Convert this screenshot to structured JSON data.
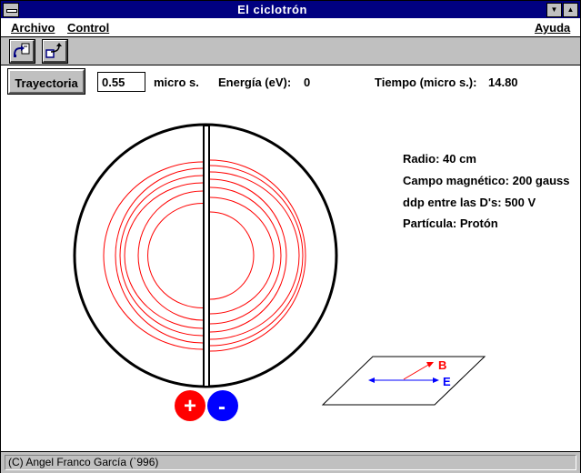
{
  "window": {
    "title": "El ciclotrón",
    "minimize_glyph": "▼",
    "maximize_glyph": "▲"
  },
  "menubar": {
    "archivo": {
      "label": "Archivo"
    },
    "control": {
      "label": "Control"
    },
    "ayuda": {
      "label": "Ayuda"
    }
  },
  "toolbar": {
    "icons": [
      "open-file-icon",
      "export-icon"
    ]
  },
  "controls": {
    "trayectoria_label": "Trayectoria",
    "time_value": "0.55",
    "time_unit": "micro s.",
    "energy_label": "Energía (eV):",
    "energy_value": "0",
    "tiempo_label": "Tiempo (micro s.):",
    "tiempo_value": "14.80"
  },
  "info": {
    "radio": "Radio: 40 cm",
    "campo": "Campo magnético: 200 gauss",
    "ddp": "ddp entre las D's: 500 V",
    "particula": "Partícula: Protón"
  },
  "terminals": {
    "positive": "+",
    "negative": "-",
    "positive_color": "#ff0000",
    "negative_color": "#0000ff"
  },
  "field_diagram": {
    "b_label": "B",
    "e_label": "E",
    "b_color": "#ff0000",
    "e_color": "#0000ff"
  },
  "trajectory_color": "#ff0000",
  "status": {
    "text": "(C) Angel Franco García (`996)"
  }
}
